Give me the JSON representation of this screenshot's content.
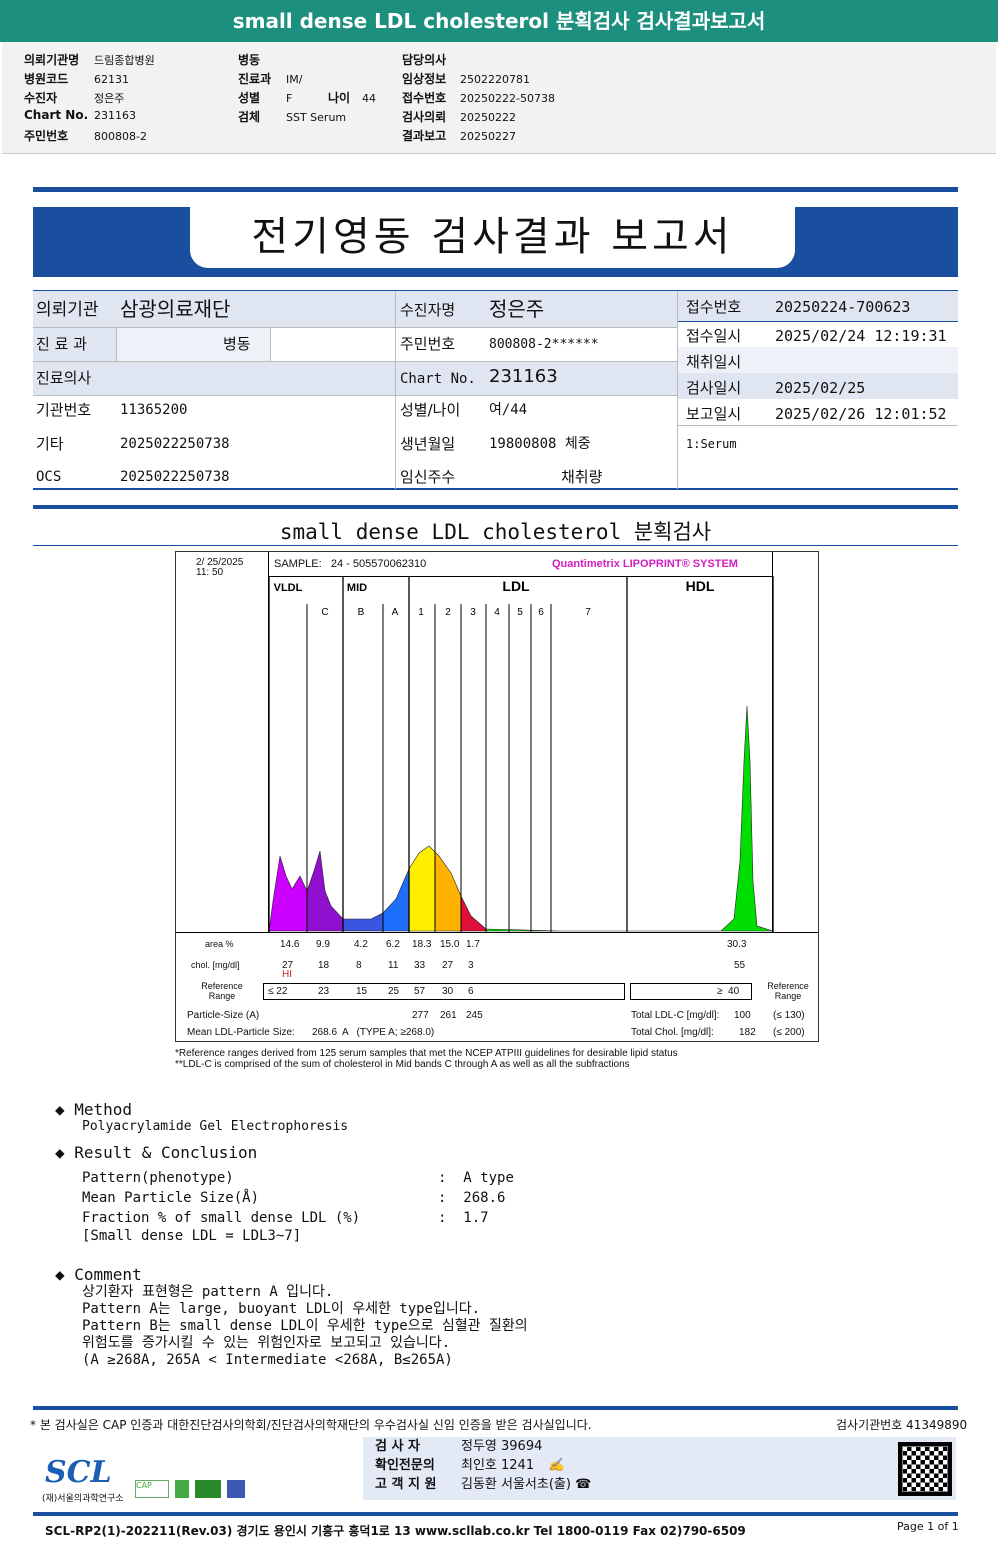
{
  "header": {
    "title": "small dense LDL cholesterol 분획검사 검사결과보고서"
  },
  "info": {
    "col1": [
      {
        "label": "의뢰기관명",
        "value": "드림종합병원"
      },
      {
        "label": "병원코드",
        "value": "62131"
      },
      {
        "label": "수진자",
        "value": "정은주"
      },
      {
        "label": "Chart No.",
        "value": "231163"
      },
      {
        "label": "주민번호",
        "value": "800808-2"
      }
    ],
    "col2": [
      {
        "label": "병동",
        "value": ""
      },
      {
        "label": "진료과",
        "value": "IM/"
      },
      {
        "label": "성별",
        "value": "F"
      },
      {
        "label": "검체",
        "value": "SST Serum"
      }
    ],
    "age_label": "나이",
    "age_value": "44",
    "col3": [
      {
        "label": "담당의사",
        "value": ""
      },
      {
        "label": "임상정보",
        "value": "2502220781"
      },
      {
        "label": "접수번호",
        "value": "20250222-50738"
      },
      {
        "label": "검사의뢰",
        "value": "20250222"
      },
      {
        "label": "결과보고",
        "value": "20250227"
      }
    ]
  },
  "report": {
    "title": "전기영동 검사결과 보고서",
    "institution_label": "의뢰기관",
    "institution": "삼광의료재단",
    "dept_label": "진 료 과",
    "ward_label": "병동",
    "doctor_label": "진료의사",
    "code_label": "기관번호",
    "code": "11365200",
    "etc_label": "기타",
    "etc": "2025022250738",
    "ocs_label": "OCS",
    "ocs": "2025022250738",
    "patient_label": "수진자명",
    "patient": "정은주",
    "rrn_label": "주민번호",
    "rrn": "800808-2******",
    "chart_label": "Chart No.",
    "chart": "231163",
    "sexage_label": "성별/나이",
    "sexage": "여/44",
    "birth_label": "생년월일",
    "birth": "19800808 체중",
    "preg_label": "임신주수",
    "collect_label": "채취량",
    "receipt_no_label": "접수번호",
    "receipt_no": "20250224-700623",
    "receipt_dt_label": "접수일시",
    "receipt_dt": "2025/02/24 12:19:31",
    "collect_dt_label": "채취일시",
    "test_dt_label": "검사일시",
    "test_dt": "2025/02/25",
    "report_dt_label": "보고일시",
    "report_dt": "2025/02/26 12:01:52",
    "specimen": "1:Serum"
  },
  "section_title": "small dense LDL cholesterol 분획검사",
  "chart_data": {
    "type": "area",
    "timestamp": "2/ 25/2025\n11: 50",
    "sample": "SAMPLE:   24 - 505570062310",
    "brand": "Quantimetrix LIPOPRINT® SYSTEM",
    "groups": [
      "VLDL",
      "MID",
      "LDL",
      "HDL"
    ],
    "bands": [
      "C",
      "B",
      "A",
      "1",
      "2",
      "3",
      "4",
      "5",
      "6",
      "7"
    ],
    "band_colors": {
      "VLDL": "#cc00ff",
      "C": "#9010d0",
      "B": "#3a55e0",
      "A": "#1f6fff",
      "1": "#ffee00",
      "2": "#ffb300",
      "3": "#e0103a",
      "HDL": "#00dd00"
    },
    "rows": {
      "area_label": "area %",
      "area": [
        "14.6",
        "9.9",
        "4.2",
        "6.2",
        "18.3",
        "15.0",
        "1.7"
      ],
      "area_hdl": "30.3",
      "chol_label": "chol. [mg/dl]",
      "chol": [
        "27",
        "18",
        "8",
        "11",
        "33",
        "27",
        "3"
      ],
      "chol_hdl": "55",
      "hi_flag": "HI",
      "ref_label": "Reference Range",
      "ref": [
        "≤ 22",
        "23",
        "15",
        "25",
        "57",
        "30",
        "6"
      ],
      "ref_hdl": "≥  40",
      "ref_label_right": "Reference Range",
      "particle_label": "Particle-Size (A)",
      "particle": [
        "277",
        "261",
        "245"
      ],
      "mean_label": "Mean LDL-Particle Size:",
      "mean": "268.6  A   (TYPE A; ≥268.0)",
      "total_ldl_label": "Total LDL-C  [mg/dl]:",
      "total_ldl": "100",
      "total_ldl_ref": "(≤ 130)",
      "total_chol_label": "Total Chol.  [mg/dl]:",
      "total_chol": "182",
      "total_chol_ref": "(≤ 200)"
    },
    "footnote1": "*Reference ranges derived from 125 serum samples that met the NCEP ATPIII guidelines for desirable lipid status",
    "footnote2": "**LDL-C is comprised of the sum of cholesterol in Mid bands C through A as well as all the subfractions"
  },
  "method": {
    "title": "Method",
    "text": "Polyacrylamide Gel Electrophoresis"
  },
  "result": {
    "title": "Result & Conclusion",
    "items": [
      {
        "k": "Pattern(phenotype)",
        "v": "A type"
      },
      {
        "k": "Mean Particle Size(Å)",
        "v": "268.6"
      },
      {
        "k": "Fraction % of small dense LDL (%)",
        "v": "1.7"
      }
    ],
    "note": "[Small dense LDL = LDL3~7]"
  },
  "comment": {
    "title": "Comment",
    "lines": [
      "상기환자 표현형은 pattern A 입니다.",
      "Pattern A는 large, buoyant LDL이 우세한 type입니다.",
      "Pattern B는 small dense LDL이 우세한 type으로 심혈관 질환의",
      "위험도를 증가시킬 수 있는 위험인자로 보고되고 있습니다.",
      "(A ≥268A, 265A < Intermediate <268A, B≤265A)"
    ]
  },
  "footer": {
    "cert": "* 본 검사실은 CAP 인증과 대한진단검사의학회/진단검사의학재단의 우수검사실 신임 인증을 받은 검사실입니다.",
    "lab_no": "검사기관번호 41349890",
    "tester_label": "검  사  자",
    "tester": "정두영 39694",
    "confirm_label": "확인전문의",
    "confirm": "최인호 1241",
    "support_label": "고 객 지 원",
    "support": "김동환 서울서초(출) ☎",
    "logo": "SCL",
    "logo_sub": "(재)서울의과학연구소",
    "address": "SCL-RP2(1)-202211(Rev.03)  경기도 용인시 기흥구 흥덕1로 13  www.scllab.co.kr  Tel 1800-0119  Fax 02)790-6509",
    "page": "Page 1 of 1"
  }
}
